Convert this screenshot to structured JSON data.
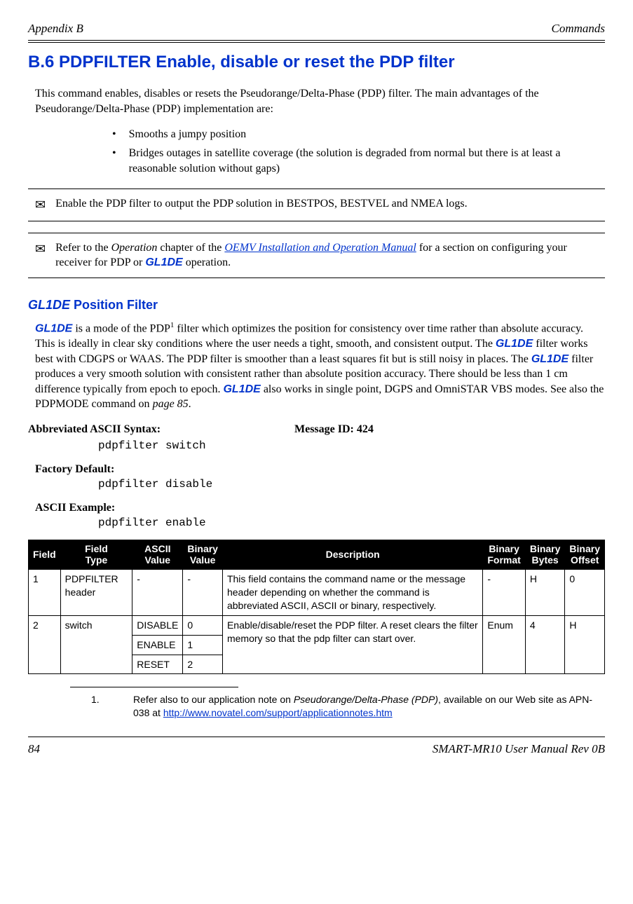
{
  "header": {
    "left": "Appendix B",
    "right": "Commands"
  },
  "title": "B.6    PDPFILTER Enable, disable or reset the PDP filter",
  "intro": "This command enables, disables or resets the Pseudorange/Delta-Phase (PDP) filter. The main advantages of the Pseudorange/Delta-Phase (PDP) implementation are:",
  "bullets": [
    "Smooths a jumpy position",
    "Bridges outages in satellite coverage (the solution is degraded from normal but there is at least a reasonable solution without gaps)"
  ],
  "note1": "Enable the PDP filter to output the PDP solution in BESTPOS, BESTVEL and NMEA logs.",
  "note2": {
    "pre": "Refer to the ",
    "italic1": "Operation",
    "mid1": " chapter of the ",
    "link": "OEMV Installation and Operation Manual",
    "mid2": " for a section on configuring your receiver for PDP or ",
    "glide": "GL1DE",
    "post": " operation."
  },
  "subtitle": {
    "glide": "GL1DE",
    "rest": " Position Filter"
  },
  "subbody": {
    "p1a": "GL1DE",
    "p1b": " is a mode of the PDP",
    "p1sup": "1",
    "p1c": " filter which optimizes the position for consistency over time rather than absolute accuracy. This is ideally in clear sky conditions where the user needs a tight, smooth, and consistent output. The ",
    "p1d": "GL1DE",
    "p1e": " filter works best with CDGPS or WAAS. The PDP filter is smoother than a least squares fit but is still noisy in places. The ",
    "p1f": "GL1DE",
    "p1g": " filter produces a very smooth solution with consistent rather than absolute position accuracy. There should be less than 1 cm difference typically from epoch to epoch. ",
    "p1h": "GL1DE",
    "p1i": " also works in single point, DGPS and OmniSTAR VBS modes. See also the PDPMODE command on ",
    "p1j_italic": "page 85",
    "p1k": "."
  },
  "syntax": {
    "label": "Abbreviated ASCII Syntax:",
    "msgid": "Message ID: 424",
    "cmd": "pdpfilter switch",
    "factory_label": "Factory Default:",
    "factory_cmd": "pdpfilter disable",
    "example_label": "ASCII Example:",
    "example_cmd": "pdpfilter enable"
  },
  "table": {
    "headers": {
      "c1": "Field",
      "c2a": "Field",
      "c2b": "Type",
      "c3a": "ASCII",
      "c3b": "Value",
      "c4a": "Binary",
      "c4b": "Value",
      "c5": "Description",
      "c6a": "Binary",
      "c6b": "Format",
      "c7a": "Binary",
      "c7b": "Bytes",
      "c8a": "Binary",
      "c8b": "Offset"
    },
    "row1": {
      "c1": "1",
      "c2": "PDPFILTER header",
      "c3": "-",
      "c4": "-",
      "c5": "This field contains the command name or the message header depending on whether the command is abbreviated ASCII, ASCII or binary, respectively.",
      "c6": "-",
      "c7": "H",
      "c8": "0"
    },
    "row2": {
      "c1": "2",
      "c2": "switch",
      "c3a": "DISABLE",
      "c4a": "0",
      "c3b": "ENABLE",
      "c4b": "1",
      "c3c": "RESET",
      "c4c": "2",
      "c5": "Enable/disable/reset the PDP filter. A reset clears the filter memory so that the pdp filter can start over.",
      "c6": "Enum",
      "c7": "4",
      "c8": "H"
    }
  },
  "footnote": {
    "num": "1.",
    "text_pre": "Refer also to our application note on ",
    "text_italic": "Pseudorange/Delta-Phase (PDP)",
    "text_mid": ", available on our Web site as APN-038 at ",
    "link": "http://www.novatel.com/support/applicationnotes.htm"
  },
  "footer": {
    "left": "84",
    "right": "SMART-MR10 User Manual Rev 0B"
  }
}
